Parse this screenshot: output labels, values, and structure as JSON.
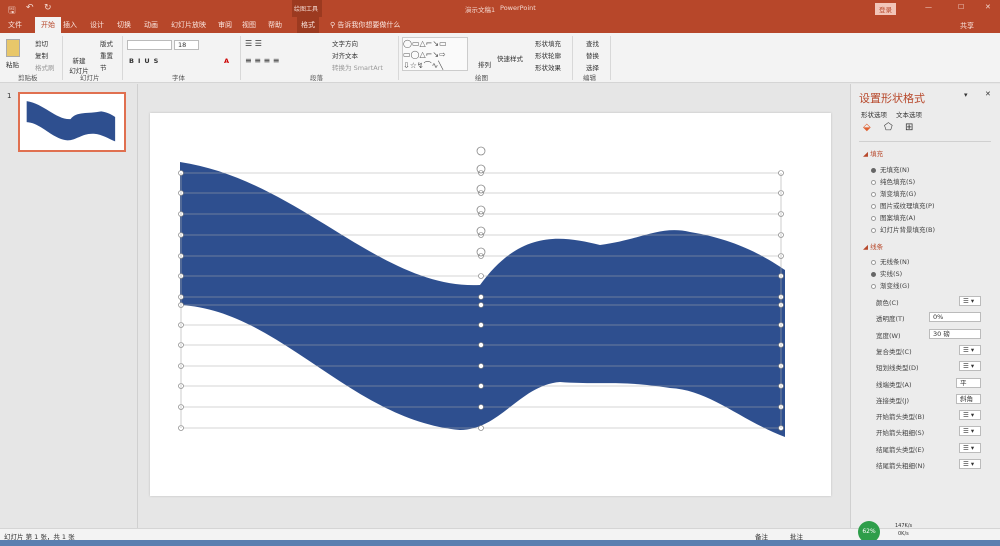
{
  "app": {
    "doc_title": "演示文稿1",
    "app_name": "PowerPoint",
    "context_tool": "绘图工具",
    "login": "登录",
    "share": "共享"
  },
  "tabs": [
    "文件",
    "开始",
    "插入",
    "设计",
    "切换",
    "动画",
    "幻灯片放映",
    "审阅",
    "视图",
    "帮助",
    "格式"
  ],
  "tell_me": "告诉我你想要做什么",
  "ribbon": {
    "clipboard": {
      "paste": "粘贴",
      "cut": "剪切",
      "copy": "复制",
      "format_painter": "格式刷",
      "label": "剪贴板"
    },
    "slides": {
      "new_slide": "新建\n幻灯片",
      "layout": "版式",
      "reset": "重置",
      "section": "节",
      "label": "幻灯片"
    },
    "font": {
      "size": "18",
      "label": "字体"
    },
    "paragraph": {
      "text_direction": "文字方向",
      "align_text": "对齐文本",
      "smartart": "转换为 SmartArt",
      "label": "段落"
    },
    "drawing": {
      "arrange": "排列",
      "quick_styles": "快速样式",
      "shape_fill": "形状填充",
      "shape_outline": "形状轮廓",
      "shape_effects": "形状效果",
      "label": "绘图"
    },
    "editing": {
      "find": "查找",
      "replace": "替换",
      "select": "选择",
      "label": "编辑"
    }
  },
  "thumbnail": {
    "number": "1"
  },
  "pane": {
    "title": "设置形状格式",
    "tab1": "形状选项",
    "tab2": "文本选项",
    "fill_header": "填充",
    "fill_options": [
      {
        "label": "无填充(N)",
        "on": true
      },
      {
        "label": "纯色填充(S)",
        "on": false
      },
      {
        "label": "渐变填充(G)",
        "on": false
      },
      {
        "label": "图片或纹理填充(P)",
        "on": false
      },
      {
        "label": "图案填充(A)",
        "on": false
      },
      {
        "label": "幻灯片背景填充(B)",
        "on": false
      }
    ],
    "line_header": "线条",
    "line_options": [
      {
        "label": "无线条(N)",
        "on": false
      },
      {
        "label": "实线(S)",
        "on": true
      },
      {
        "label": "渐变线(G)",
        "on": false
      }
    ],
    "props": [
      {
        "label": "颜色(C)"
      },
      {
        "label": "透明度(T)",
        "value": "0%"
      },
      {
        "label": "宽度(W)",
        "value": "30 磅"
      },
      {
        "label": "复合类型(C)"
      },
      {
        "label": "短划线类型(D)"
      },
      {
        "label": "线端类型(A)",
        "value": "平"
      },
      {
        "label": "连接类型(J)",
        "value": "斜角"
      },
      {
        "label": "开始箭头类型(B)"
      },
      {
        "label": "开始箭头粗细(S)"
      },
      {
        "label": "结尾箭头类型(E)"
      },
      {
        "label": "结尾箭头粗细(N)"
      }
    ]
  },
  "status": {
    "slide_info": "幻灯片 第 1 张，共 1 张",
    "notes": "备注",
    "comments": "批注",
    "battery": "62%",
    "net_up": "147K/s",
    "net_down": "0K/s"
  },
  "colors": {
    "accent": "#b7472a",
    "shape": "#2e4f8f"
  }
}
